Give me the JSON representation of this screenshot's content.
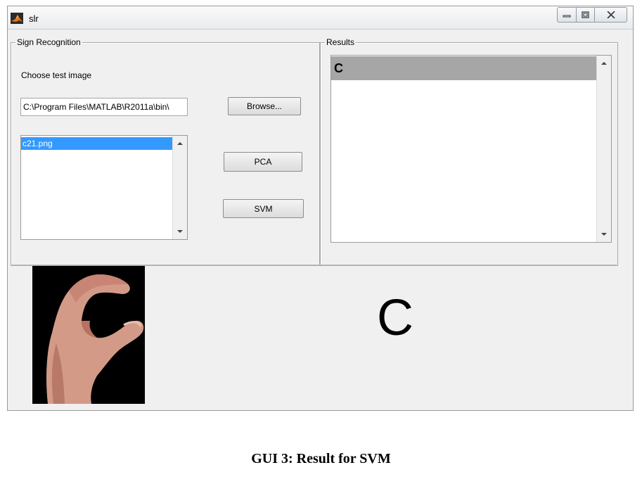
{
  "window": {
    "title": "slr",
    "controls": {
      "minimize": "minimize-icon",
      "maximize": "maximize-icon",
      "close": "close-icon"
    }
  },
  "sign_panel": {
    "title": "Sign Recognition",
    "choose_label": "Choose test image",
    "path_value": "C:\\Program Files\\MATLAB\\R2011a\\bin\\",
    "browse_label": "Browse...",
    "pca_label": "PCA",
    "svm_label": "SVM",
    "file_list": {
      "items": [
        "c21.png"
      ],
      "selected": "c21.png"
    }
  },
  "results_panel": {
    "title": "Results",
    "items": [
      "C"
    ]
  },
  "result_display": {
    "letter": "C"
  },
  "caption": "GUI 3: Result for SVM",
  "colors": {
    "selection_blue": "#3399ff",
    "results_highlight": "#a6a6a6",
    "window_bg": "#f0f0f0"
  }
}
